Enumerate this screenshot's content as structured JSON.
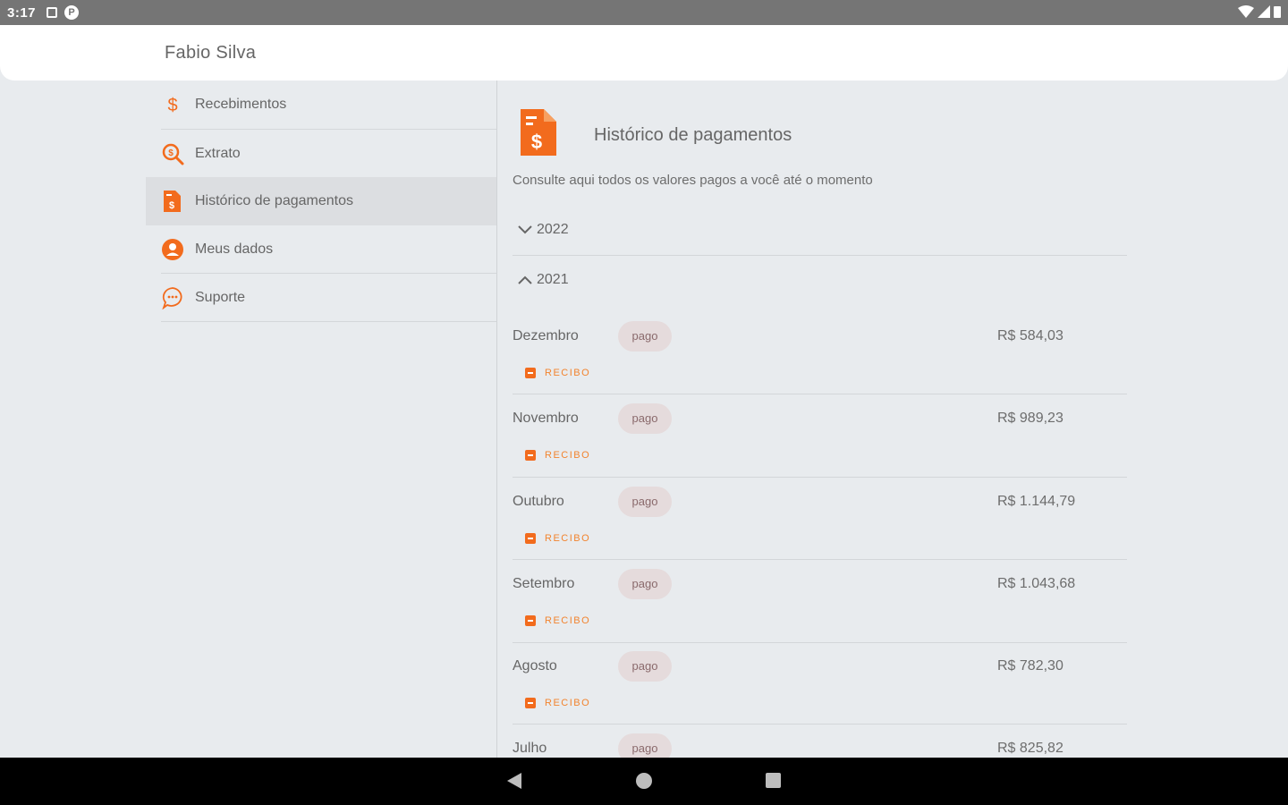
{
  "status": {
    "time": "3:17",
    "notif_icons": [
      "sim-card-icon",
      "p-icon"
    ],
    "right_icons": [
      "wifi-icon",
      "signal-icon",
      "battery-icon"
    ]
  },
  "header": {
    "user_name": "Fabio Silva"
  },
  "sidebar": {
    "items": [
      {
        "label": "Recebimentos",
        "icon": "dollar-icon"
      },
      {
        "label": "Extrato",
        "icon": "search-money-icon"
      },
      {
        "label": "Histórico de pagamentos",
        "icon": "document-dollar-icon",
        "active": true
      },
      {
        "label": "Meus dados",
        "icon": "user-icon"
      },
      {
        "label": "Suporte",
        "icon": "chat-icon"
      }
    ]
  },
  "main": {
    "title": "Histórico de pagamentos",
    "subtitle": "Consulte aqui todos os valores pagos a você até o momento",
    "years": [
      {
        "label": "2022",
        "expanded": false
      },
      {
        "label": "2021",
        "expanded": true
      }
    ],
    "receipt_label": "RECIBO",
    "payments": [
      {
        "month": "Dezembro",
        "status": "pago",
        "amount": "R$ 584,03"
      },
      {
        "month": "Novembro",
        "status": "pago",
        "amount": "R$ 989,23"
      },
      {
        "month": "Outubro",
        "status": "pago",
        "amount": "R$ 1.144,79"
      },
      {
        "month": "Setembro",
        "status": "pago",
        "amount": "R$ 1.043,68"
      },
      {
        "month": "Agosto",
        "status": "pago",
        "amount": "R$ 782,30"
      },
      {
        "month": "Julho",
        "status": "pago",
        "amount": "R$ 825,82"
      }
    ]
  },
  "colors": {
    "accent": "#f26b1d",
    "badge_bg": "#e5dbdc",
    "background": "#e8ebee"
  }
}
